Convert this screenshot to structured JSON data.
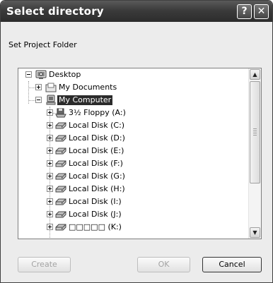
{
  "window": {
    "title": "Select directory",
    "help_glyph": "?",
    "close_glyph": "✕"
  },
  "subtitle": "Set Project Folder",
  "tree": {
    "root": {
      "label": "Desktop",
      "icon": "desktop-icon",
      "expanded": true
    },
    "children": [
      {
        "label": "My Documents",
        "icon": "folder-documents-icon",
        "expanded": false
      },
      {
        "label": "My Computer",
        "icon": "computer-icon",
        "expanded": true,
        "selected": true
      }
    ],
    "drives": [
      {
        "label": "3½ Floppy (A:)",
        "icon": "floppy-drive-icon"
      },
      {
        "label": "Local Disk (C:)",
        "icon": "disk-drive-icon"
      },
      {
        "label": "Local Disk (D:)",
        "icon": "disk-drive-icon"
      },
      {
        "label": "Local Disk (E:)",
        "icon": "disk-drive-icon"
      },
      {
        "label": "Local Disk (F:)",
        "icon": "disk-drive-icon"
      },
      {
        "label": "Local Disk (G:)",
        "icon": "disk-drive-icon"
      },
      {
        "label": "Local Disk (H:)",
        "icon": "disk-drive-icon"
      },
      {
        "label": "Local Disk (I:)",
        "icon": "disk-drive-icon"
      },
      {
        "label": "Local Disk (J:)",
        "icon": "disk-drive-icon"
      },
      {
        "label": "□□□□□ (K:)",
        "icon": "disk-drive-icon"
      }
    ]
  },
  "scrollbar": {
    "up_glyph": "▲",
    "down_glyph": "▼"
  },
  "buttons": {
    "create": "Create",
    "ok": "OK",
    "cancel": "Cancel"
  }
}
